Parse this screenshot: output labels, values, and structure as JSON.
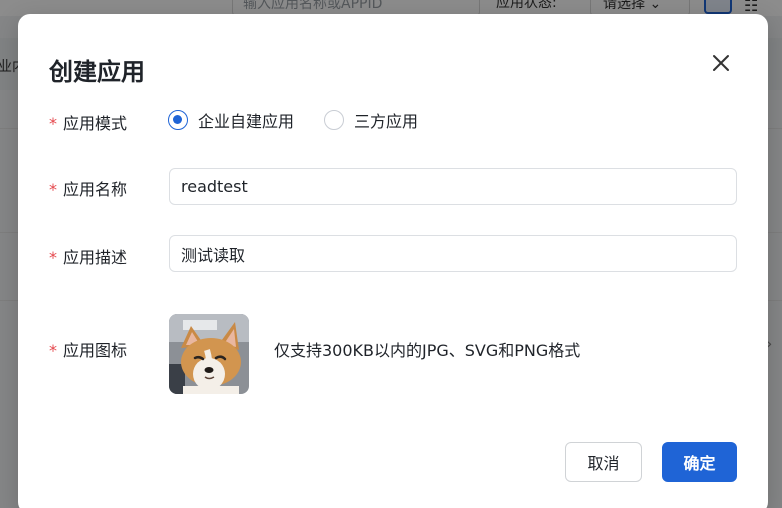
{
  "background": {
    "search_placeholder": "输入应用名称或APPID",
    "status_label": "应用状态:",
    "status_select": "请选择 ⌄",
    "tab_text": "业内"
  },
  "modal": {
    "title": "创建应用",
    "close_icon": "close-icon",
    "required_mark": "*",
    "mode": {
      "label": "应用模式",
      "options": [
        {
          "label": "企业自建应用",
          "checked": true
        },
        {
          "label": "三方应用",
          "checked": false
        }
      ]
    },
    "name": {
      "label": "应用名称",
      "value": "readtest"
    },
    "description": {
      "label": "应用描述",
      "value": "测试读取"
    },
    "icon": {
      "label": "应用图标",
      "image": "corgi-avatar",
      "hint": "仅支持300KB以内的JPG、SVG和PNG格式"
    },
    "buttons": {
      "cancel": "取消",
      "confirm": "确定"
    }
  },
  "colors": {
    "primary": "#1f64d6",
    "required": "#e5484d",
    "overlay": "rgba(0,0,0,0.45)"
  }
}
